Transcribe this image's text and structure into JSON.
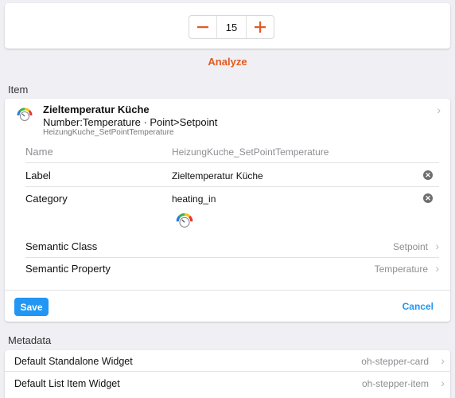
{
  "stepper": {
    "value": "15",
    "minus_label": "−",
    "plus_label": "+"
  },
  "analyze_label": "Analyze",
  "item_section_title": "Item",
  "item": {
    "title": "Zieltemperatur Küche",
    "subtitle": "Number:Temperature · Point>Setpoint",
    "footer": "HeizungKuche_SetPointTemperature"
  },
  "fields": {
    "name": {
      "label": "Name",
      "value": "HeizungKuche_SetPointTemperature"
    },
    "label": {
      "label": "Label",
      "value": "Zieltemperatur Küche"
    },
    "category": {
      "label": "Category",
      "value": "heating_in"
    },
    "semantic_class": {
      "label": "Semantic Class",
      "value": "Setpoint"
    },
    "semantic_property": {
      "label": "Semantic Property",
      "value": "Temperature"
    }
  },
  "actions": {
    "save_label": "Save",
    "cancel_label": "Cancel"
  },
  "metadata_section_title": "Metadata",
  "metadata": [
    {
      "label": "Default Standalone Widget",
      "value": "oh-stepper-card"
    },
    {
      "label": "Default List Item Widget",
      "value": "oh-stepper-item"
    }
  ],
  "colors": {
    "accent": "#e35a1f",
    "primary": "#2196f3",
    "background": "#efeff4"
  }
}
